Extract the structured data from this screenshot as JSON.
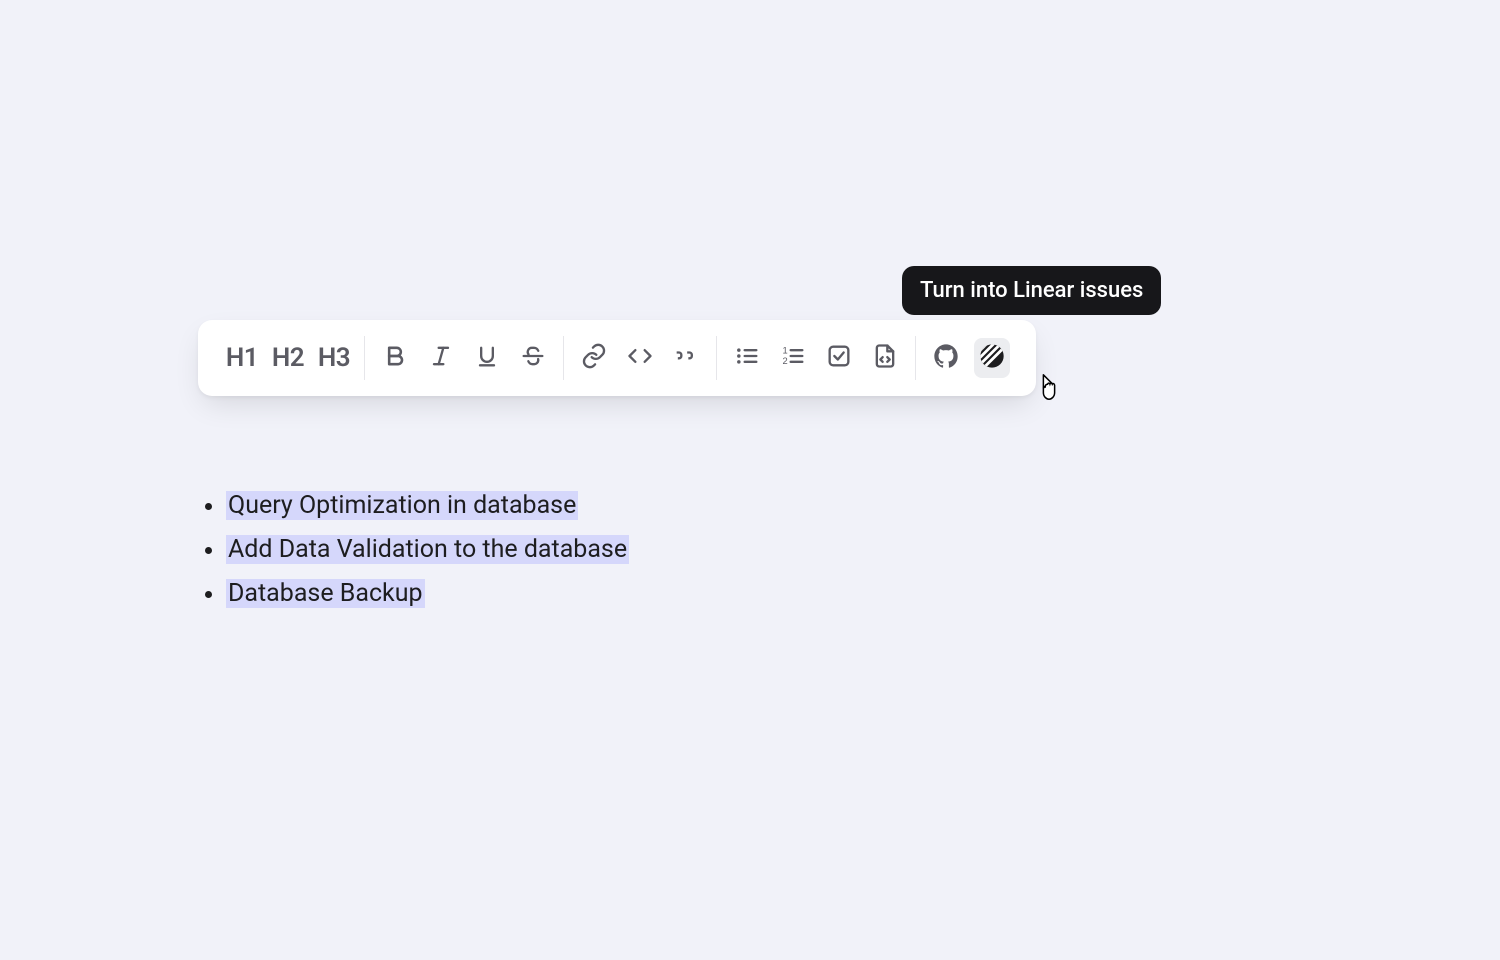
{
  "toolbar": {
    "headings": {
      "h1": "H1",
      "h2": "H2",
      "h3": "H3"
    }
  },
  "tooltip": {
    "linear": "Turn into Linear issues"
  },
  "content": {
    "items": [
      "Query Optimization in database",
      "Add Data Validation to the database",
      "Database Backup"
    ]
  }
}
